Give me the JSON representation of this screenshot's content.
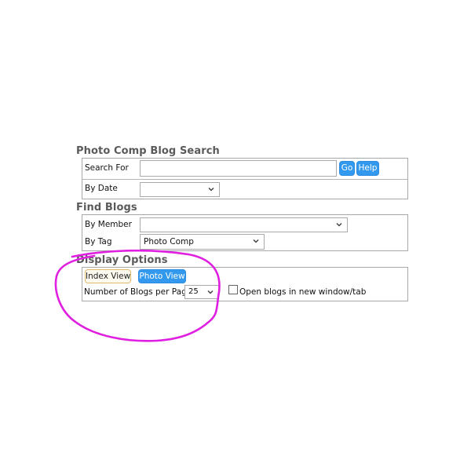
{
  "search_section": {
    "title": "Photo Comp Blog Search",
    "search_for_label": "Search For",
    "search_value": "",
    "go_label": "Go",
    "help_label": "Help",
    "by_date_label": "By Date",
    "by_date_value": ""
  },
  "find_section": {
    "title": "Find Blogs",
    "by_member_label": "By Member",
    "by_member_value": "",
    "by_tag_label": "By Tag",
    "by_tag_value": "Photo Comp"
  },
  "display_section": {
    "title": "Display Options",
    "index_view_label": "Index View",
    "photo_view_label": "Photo View",
    "blogs_per_page_label": "Number of Blogs per Page",
    "blogs_per_page_value": "25",
    "new_window_label": "Open blogs in new window/tab",
    "new_window_checked": false
  },
  "colors": {
    "accent_blue": "#3399ee",
    "annotation_magenta": "#e020e0"
  }
}
